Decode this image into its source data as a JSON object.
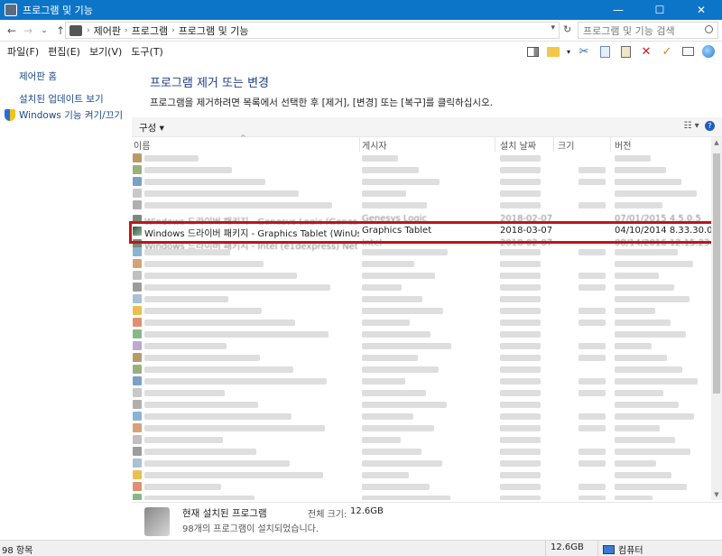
{
  "window": {
    "title": "프로그램 및 기능",
    "minimize": "—",
    "maximize": "☐",
    "close": "✕"
  },
  "nav": {
    "back": "←",
    "forward": "→",
    "dropdown": "⌄",
    "up": "↑",
    "refresh": "↻"
  },
  "address": {
    "breadcrumbs": [
      "제어판",
      "프로그램",
      "프로그램 및 기능"
    ]
  },
  "search": {
    "placeholder": "프로그램 및 기능 검색"
  },
  "menu": [
    "파일(F)",
    "편집(E)",
    "보기(V)",
    "도구(T)"
  ],
  "sidebar": {
    "home": "제어판 홈",
    "updates": "설치된 업데이트 보기",
    "features": "Windows 기능 켜기/끄기"
  },
  "main": {
    "heading": "프로그램 제거 또는 변경",
    "subtext": "프로그램을 제거하려면 목록에서 선택한 후 [제거], [변경] 또는 [복구]를 클릭하십시오.",
    "organize": "구성 ▾"
  },
  "columns": {
    "name": "이름",
    "publisher": "게시자",
    "install_date": "설치 날짜",
    "size": "크기",
    "version": "버전"
  },
  "rows": {
    "above": {
      "name": "Windows 드라이버 패키지 - Genesys Logic (GenesStor) USB",
      "publisher": "Genesys Logic",
      "install_date": "2018-02-07",
      "version": "07/01/2015 4.5.0.5"
    },
    "selected": {
      "name": "Windows 드라이버 패키지 - Graphics Tablet (WinUsb) USB...",
      "publisher": "Graphics Tablet",
      "install_date": "2018-03-07",
      "version": "04/10/2014 8.33.30.0"
    },
    "below": {
      "name": "Windows 드라이버 패키지 - Intel (e1dexpress) Net (00.0.14...",
      "publisher": "Intel",
      "install_date": "2018-02-07",
      "version": "08/14/2016 12.15.23.7"
    }
  },
  "details": {
    "title": "현재 설치된 프로그램",
    "total_size_label": "전체 크기:",
    "total_size": "12.6GB",
    "count_text": "98개의 프로그램이 설치되었습니다."
  },
  "status": {
    "items": "98 항목",
    "size": "12.6GB",
    "location": "컴퓨터"
  },
  "colors": {
    "titlebar": "#0d75c8",
    "link": "#1a4a8a",
    "heading": "#1e3c8c",
    "highlight": "#c0141a"
  }
}
